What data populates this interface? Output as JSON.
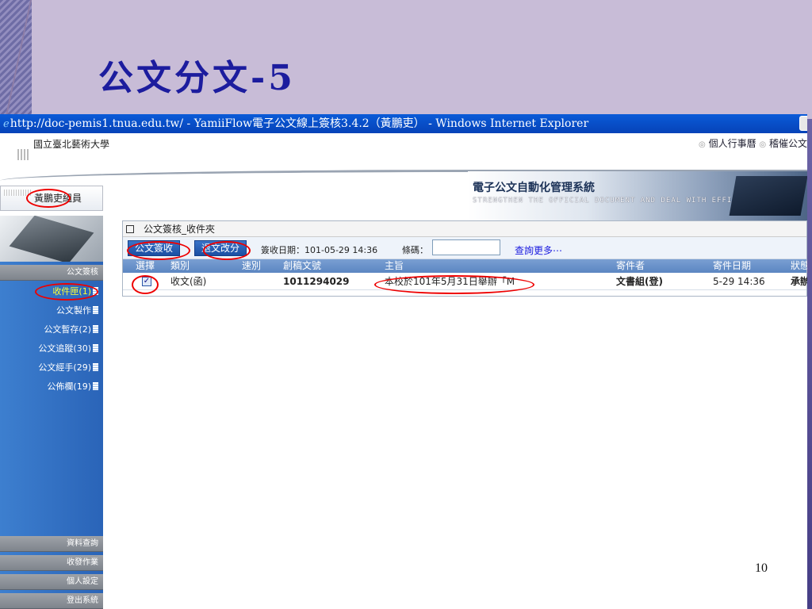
{
  "slide": {
    "title": "公文分文-5",
    "page_number": "10"
  },
  "browser": {
    "title": "http://doc-pemis1.tnua.edu.tw/ - YamiiFlow電子公文線上簽核3.4.2（黃鵬吏） - Windows Internet Explorer"
  },
  "header": {
    "school_name": "國立臺北藝術大學",
    "link_calendar": "個人行事曆",
    "link_urge": "稽催公文",
    "banner_title": "電子公文自動化管理系統",
    "banner_sub": "STRENGTHEN THE OFFICIAL DOCUMENT AND DEAL WITH EFFICIENCY.",
    "user": "黃鵬吏組員"
  },
  "sidebar": {
    "section_docs": "公文簽核",
    "items": [
      {
        "label": "收件匣(1)"
      },
      {
        "label": "公文製作"
      },
      {
        "label": "公文暫存(2)"
      },
      {
        "label": "公文追蹤(30)"
      },
      {
        "label": "公文經手(29)"
      },
      {
        "label": "公佈欄(19)"
      }
    ],
    "bottom_sections": [
      "資料查詢",
      "收發作業",
      "個人設定",
      "登出系統"
    ]
  },
  "panel": {
    "title": "公文簽核_收件夾",
    "btn_sign": "公文簽收",
    "btn_return": "退文改分",
    "sign_date": "簽收日期：101-05-29 14:36",
    "barcode_label": "條碼：",
    "more_link": "查詢更多⋯",
    "columns": {
      "select": "選擇",
      "type": "類別",
      "speed": "速別",
      "doc_no": "創稿文號",
      "subject": "主旨",
      "sender": "寄件者",
      "date": "寄件日期",
      "status": "狀態"
    },
    "rows": [
      {
        "type": "收文(函)",
        "speed": "",
        "doc_no": "1011294029",
        "subject": "本校於101年5月31日舉辦「M",
        "sender": "文書組(登)",
        "date": "5-29 14:36",
        "status": "承辦"
      }
    ]
  }
}
